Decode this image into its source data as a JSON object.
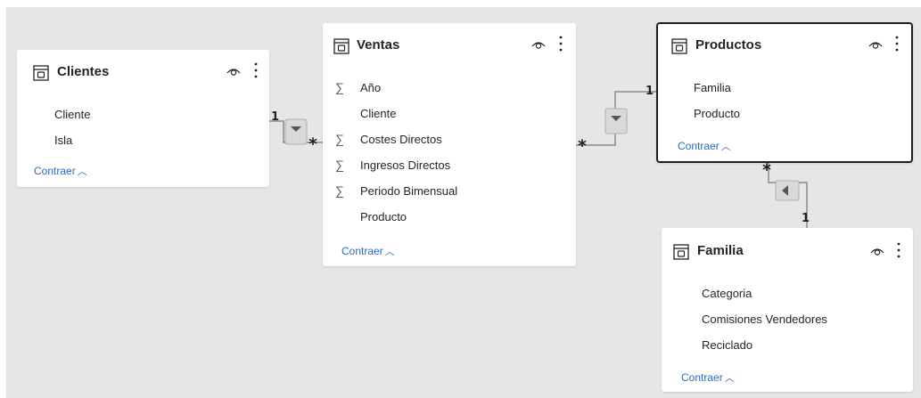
{
  "tables": {
    "clientes": {
      "title": "Clientes",
      "fields": [
        "Cliente",
        "Isla"
      ],
      "collapse_label": "Contraer"
    },
    "ventas": {
      "title": "Ventas",
      "fields": [
        {
          "name": "Año",
          "sigma": true
        },
        {
          "name": "Cliente",
          "sigma": false
        },
        {
          "name": "Costes Directos",
          "sigma": true
        },
        {
          "name": "Ingresos Directos",
          "sigma": true
        },
        {
          "name": "Periodo Bimensual",
          "sigma": true
        },
        {
          "name": "Producto",
          "sigma": false
        }
      ],
      "collapse_label": "Contraer"
    },
    "productos": {
      "title": "Productos",
      "fields": [
        "Familia",
        "Producto"
      ],
      "collapse_label": "Contraer",
      "selected": true
    },
    "familia": {
      "title": "Familia",
      "fields": [
        "Categoria",
        "Comisiones Vendedores",
        "Reciclado"
      ],
      "collapse_label": "Contraer"
    }
  },
  "sigma_symbol": "∑",
  "chevron_up": "︿",
  "relationships": {
    "clientes_ventas": {
      "from_card": "1",
      "to_card": "*"
    },
    "ventas_productos": {
      "from_card": "*",
      "to_card": "1"
    },
    "productos_familia": {
      "from_card": "*",
      "to_card": "1"
    }
  },
  "colors": {
    "canvas": "#e6e6e6",
    "link": "#2b6cb5",
    "line": "#7a7a7a"
  }
}
